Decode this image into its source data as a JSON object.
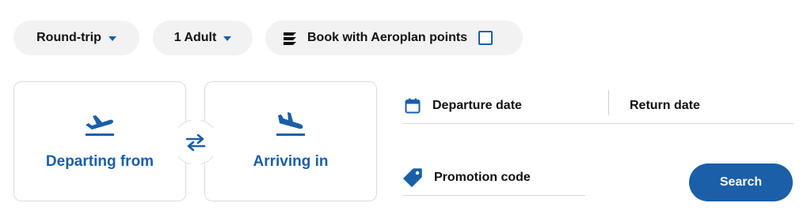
{
  "options": {
    "trip_type": "Round-trip",
    "passengers": "1 Adult",
    "points_label": "Book with Aeroplan points",
    "points_checked": false
  },
  "locations": {
    "from_label": "Departing from",
    "to_label": "Arriving in"
  },
  "dates": {
    "departure_label": "Departure date",
    "return_label": "Return date"
  },
  "promo": {
    "label": "Promotion code"
  },
  "actions": {
    "search_label": "Search"
  },
  "colors": {
    "brand": "#1a5fa8",
    "pill_bg": "#f2f2f2",
    "border": "#dcdcdc"
  },
  "icons": {
    "trip_caret": "chevron-down-icon",
    "aeroplan": "aeroplan-logo-icon",
    "departure": "plane-takeoff-icon",
    "arrival": "plane-landing-icon",
    "swap": "swap-arrows-icon",
    "calendar": "calendar-icon",
    "promo": "tag-icon"
  }
}
